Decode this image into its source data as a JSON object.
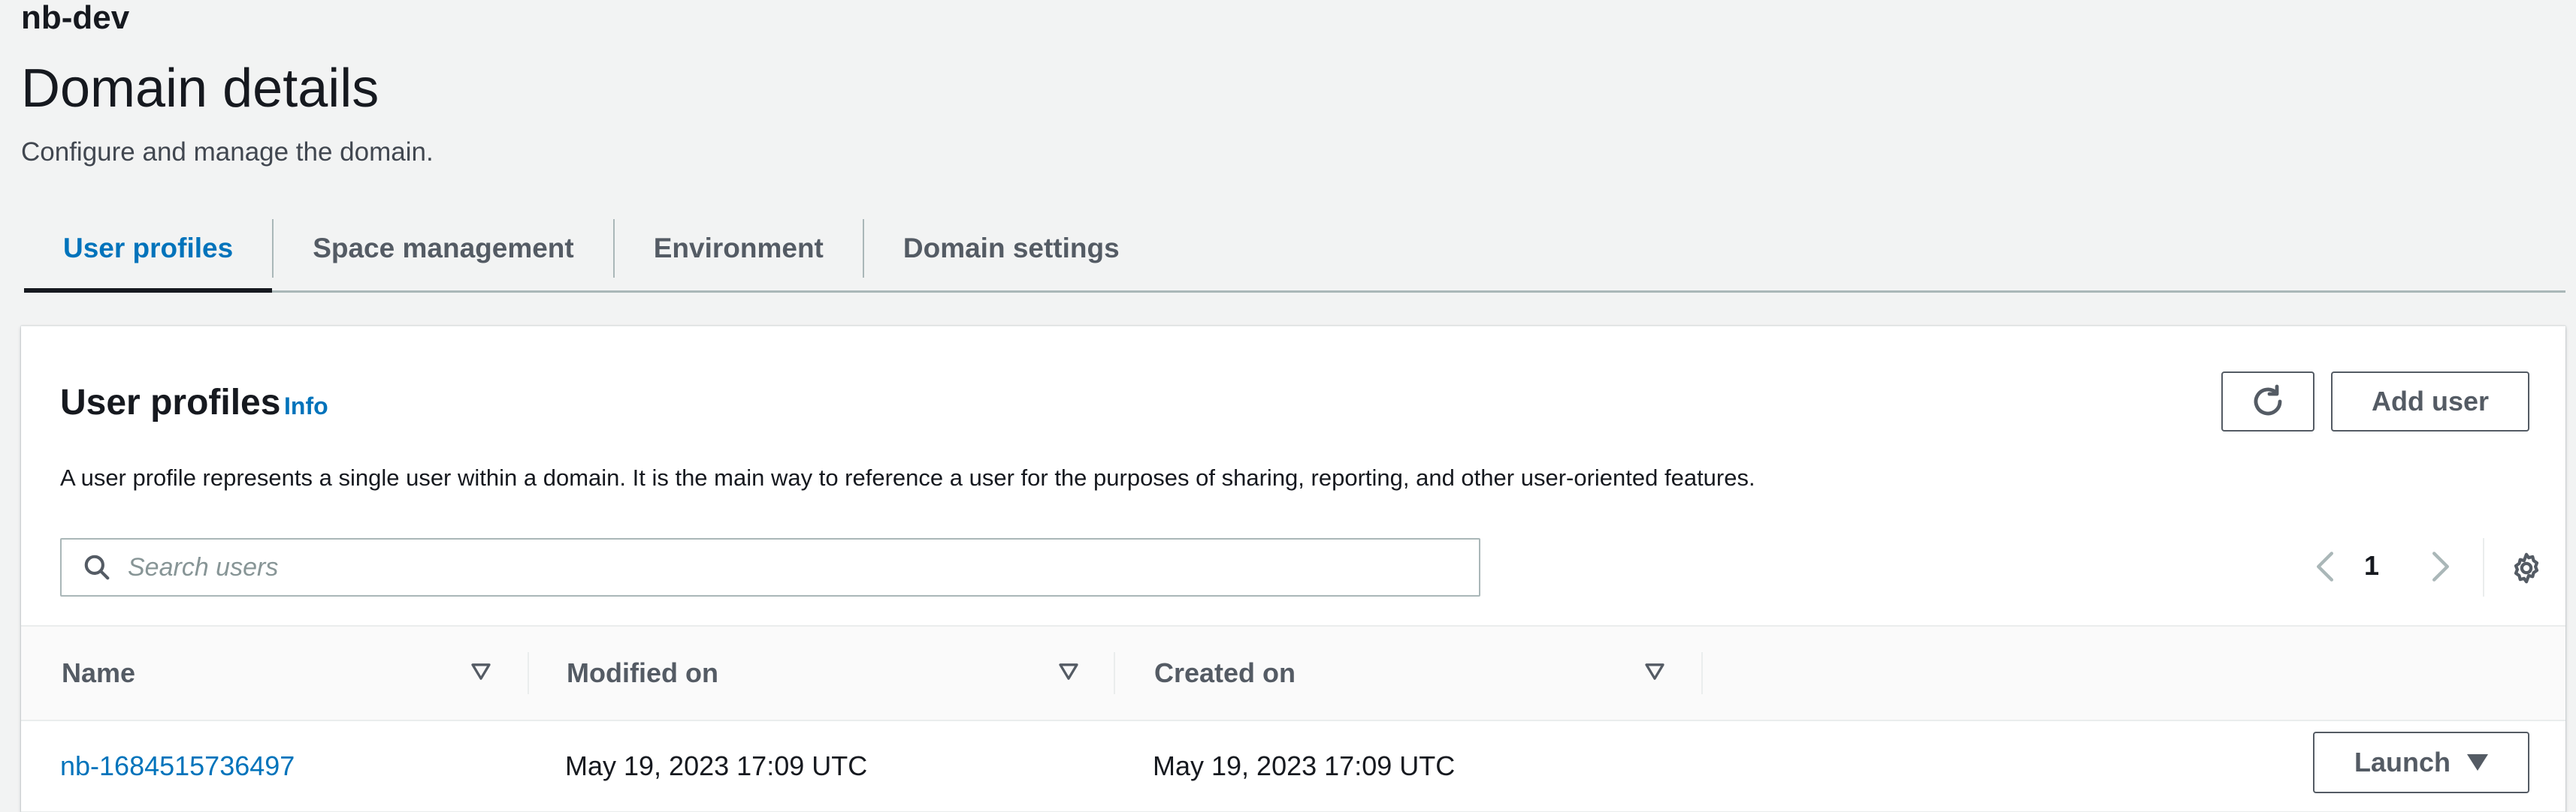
{
  "header": {
    "domain_name": "nb-dev",
    "title": "Domain details",
    "description": "Configure and manage the domain."
  },
  "tabs": [
    {
      "label": "User profiles",
      "active": true
    },
    {
      "label": "Space management",
      "active": false
    },
    {
      "label": "Environment",
      "active": false
    },
    {
      "label": "Domain settings",
      "active": false
    }
  ],
  "panel": {
    "title": "User profiles",
    "info_label": "Info",
    "add_user_label": "Add user",
    "refresh_icon": "refresh-icon",
    "description": "A user profile represents a single user within a domain. It is the main way to reference a user for the purposes of sharing, reporting, and other user-oriented features.",
    "search": {
      "placeholder": "Search users",
      "value": ""
    },
    "pagination": {
      "current_page": "1"
    },
    "columns": [
      {
        "label": "Name"
      },
      {
        "label": "Modified on"
      },
      {
        "label": "Created on"
      }
    ],
    "rows": [
      {
        "name": "nb-1684515736497",
        "modified_on": "May 19, 2023 17:09 UTC",
        "created_on": "May 19, 2023 17:09 UTC",
        "action_label": "Launch"
      }
    ]
  },
  "colors": {
    "link": "#0073bb",
    "text": "#16191f",
    "muted": "#545b64",
    "border": "#aab7b8",
    "background": "#f2f3f3"
  }
}
